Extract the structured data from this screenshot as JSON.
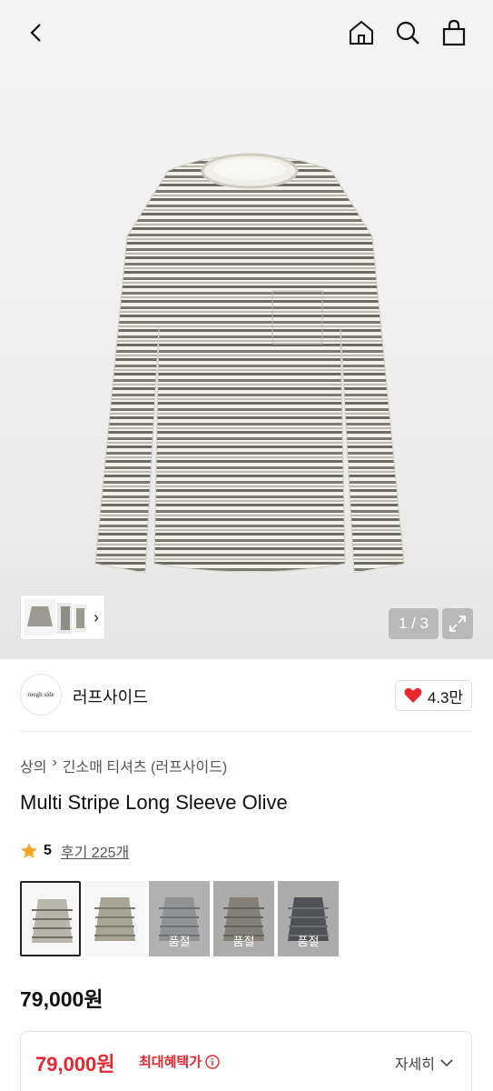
{
  "gallery": {
    "counter": "1 / 3"
  },
  "brand": {
    "logo_text": "rough side",
    "name": "러프사이드",
    "likes": "4.3만"
  },
  "breadcrumb": [
    "상의",
    "긴소매 티셔츠 (러프사이드)"
  ],
  "product": {
    "title": "Multi Stripe Long Sleeve Olive",
    "rating": "5",
    "reviews": "후기 225개",
    "price": "79,000원"
  },
  "variants": [
    {
      "color": "#b8b5ab",
      "stripe": "#6f6f66",
      "sold_label": ""
    },
    {
      "color": "#a8a596",
      "stripe": "#7c7a6a",
      "sold_label": ""
    },
    {
      "color": "#9da0a2",
      "stripe": "#6a6e72",
      "sold_label": "품절"
    },
    {
      "color": "#8a8478",
      "stripe": "#5c574e",
      "sold_label": "품절"
    },
    {
      "color": "#3b3e46",
      "stripe": "#676a72",
      "sold_label": "품절"
    }
  ],
  "benefit": {
    "price": "79,000원",
    "label": "최대혜택가",
    "detail": "자세히"
  },
  "colors": {
    "accent_red": "#e8262d",
    "heart": "#e8262d"
  }
}
